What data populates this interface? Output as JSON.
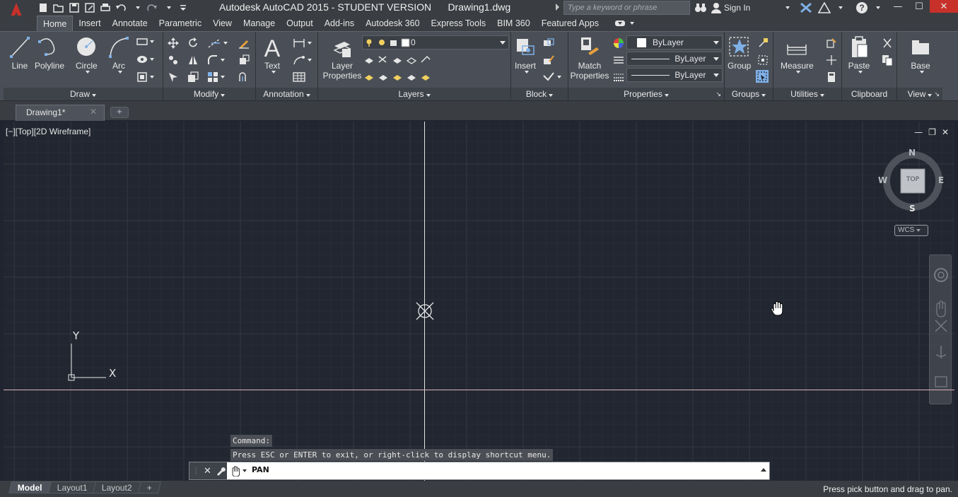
{
  "titlebar": {
    "app_title": "Autodesk AutoCAD 2015 - STUDENT VERSION",
    "document_name": "Drawing1.dwg",
    "search_placeholder": "Type a keyword or phrase",
    "sign_in": "Sign In"
  },
  "ribbon_tabs": [
    "Home",
    "Insert",
    "Annotate",
    "Parametric",
    "View",
    "Manage",
    "Output",
    "Add-ins",
    "Autodesk 360",
    "Express Tools",
    "BIM 360",
    "Featured Apps"
  ],
  "active_tab": "Home",
  "panels": {
    "draw": {
      "title": "Draw",
      "tools": [
        "Line",
        "Polyline",
        "Circle",
        "Arc"
      ]
    },
    "modify": {
      "title": "Modify"
    },
    "annotation": {
      "title": "Annotation",
      "text_label": "Text"
    },
    "layers": {
      "title": "Layers",
      "layer_properties": "Layer Properties",
      "current_layer": "0"
    },
    "block": {
      "title": "Block",
      "insert": "Insert"
    },
    "properties": {
      "title": "Properties",
      "match_properties": "Match Properties",
      "color": "ByLayer",
      "linetype": "ByLayer",
      "lineweight": "ByLayer"
    },
    "groups": {
      "title": "Groups",
      "group": "Group"
    },
    "utilities": {
      "title": "Utilities",
      "measure": "Measure"
    },
    "clipboard": {
      "title": "Clipboard",
      "paste": "Paste"
    },
    "view": {
      "title": "View",
      "base": "Base"
    }
  },
  "file_tab": {
    "label": "Drawing1*"
  },
  "viewport": {
    "label": "[−][Top][2D Wireframe]",
    "viewcube": {
      "north": "N",
      "south": "S",
      "east": "E",
      "west": "W",
      "face": "TOP"
    },
    "wcs": "WCS",
    "ucs_x": "X",
    "ucs_y": "Y"
  },
  "command": {
    "history_1": "Command:",
    "history_2": "Press ESC or ENTER to exit, or right-click to display shortcut menu.",
    "current": "PAN"
  },
  "layout_tabs": [
    "Model",
    "Layout1",
    "Layout2"
  ],
  "status_message": "Press pick button and drag to pan.",
  "colors": {
    "accent_red": "#c7312a",
    "viewport_bg": "#212630",
    "ribbon_bg": "#4a4f57"
  }
}
